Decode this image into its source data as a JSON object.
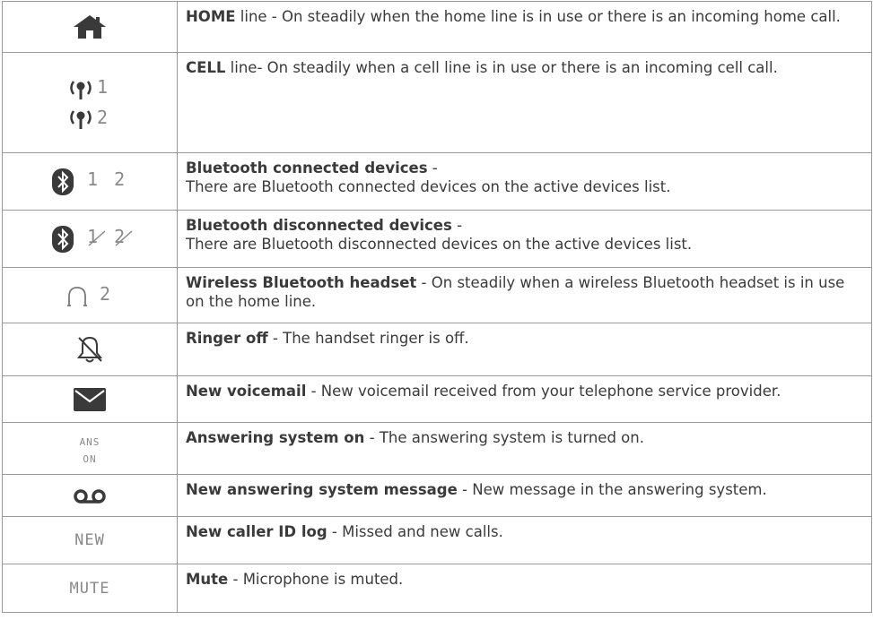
{
  "rows": [
    {
      "icon": "home-icon",
      "bold": "HOME",
      "rest": " line - On steadily when the home line is in use or there is an incoming home call.",
      "rest2": ""
    },
    {
      "icon": "cell-signal-icon",
      "icon_text_1": "1",
      "icon_text_2": "2",
      "bold": "CELL",
      "rest": " line- On steadily when a cell line is in use or there is an incoming cell call.",
      "rest2": ""
    },
    {
      "icon": "bluetooth-icon",
      "icon_text": "1 2",
      "bold": "Bluetooth connected devices",
      "rest": " -",
      "rest2": "There are Bluetooth connected devices on the active devices list."
    },
    {
      "icon": "bluetooth-icon",
      "icon_text": "1 2",
      "bold": "Bluetooth disconnected devices",
      "rest": " -",
      "rest2": "There are Bluetooth disconnected devices on the active devices list."
    },
    {
      "icon": "headset-icon",
      "icon_text": "2",
      "bold": "Wireless Bluetooth headset",
      "rest": " - On steadily when a wireless Bluetooth headset is in use on the home line.",
      "rest2": ""
    },
    {
      "icon": "ringer-off-icon",
      "bold": "Ringer off",
      "rest": " - The handset ringer is off.",
      "rest2": ""
    },
    {
      "icon": "envelope-icon",
      "bold": "New voicemail",
      "rest": " - New voicemail received from your telephone service provider.",
      "rest2": ""
    },
    {
      "icon": "ans-on-icon",
      "icon_text_1": "ANS",
      "icon_text_2": "ON",
      "bold": "Answering system on",
      "rest": " - The answering system is turned on.",
      "rest2": ""
    },
    {
      "icon": "tape-icon",
      "bold": "New answering system message",
      "rest": " - New message in the answering system.",
      "rest2": ""
    },
    {
      "icon": "new-icon",
      "icon_text": "NEW",
      "bold": "New caller ID log",
      "rest": " - Missed and new calls.",
      "rest2": ""
    },
    {
      "icon": "mute-icon",
      "icon_text": "MUTE",
      "bold": "Mute",
      "rest": " - Microphone is muted.",
      "rest2": ""
    }
  ]
}
